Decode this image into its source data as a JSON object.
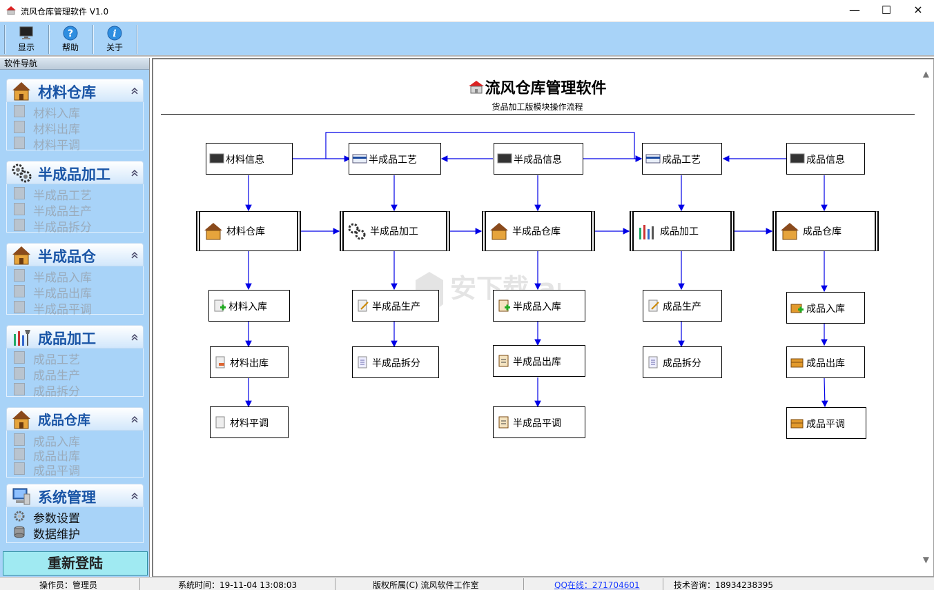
{
  "window": {
    "title": "流风仓库管理软件 V1.0",
    "min_glyph": "—",
    "max_glyph": "☐",
    "close_glyph": "✕"
  },
  "toolbar": {
    "buttons": [
      {
        "label": "显示",
        "icon": "monitor-icon"
      },
      {
        "label": "帮助",
        "icon": "help-icon"
      },
      {
        "label": "关于",
        "icon": "info-icon"
      }
    ]
  },
  "sidebar": {
    "title": "软件导航",
    "groups": [
      {
        "title": "材料仓库",
        "icon": "warehouse-house-icon",
        "items": [
          "材料入库",
          "材料出库",
          "材料平调"
        ],
        "active": false
      },
      {
        "title": "半成品加工",
        "icon": "gears-icon",
        "items": [
          "半成品工艺",
          "半成品生产",
          "半成品拆分"
        ],
        "active": false
      },
      {
        "title": "半成品仓",
        "icon": "warehouse-house-icon",
        "items": [
          "半成品入库",
          "半成品出库",
          "半成品平调"
        ],
        "active": false
      },
      {
        "title": "成品加工",
        "icon": "tools-icon",
        "items": [
          "成品工艺",
          "成品生产",
          "成品拆分"
        ],
        "active": false
      },
      {
        "title": "成品仓库",
        "icon": "warehouse-house-icon",
        "items": [
          "成品入库",
          "成品出库",
          "成品平调"
        ],
        "active": false
      },
      {
        "title": "系统管理",
        "icon": "computer-icon",
        "items": [
          "参数设置",
          "数据维护"
        ],
        "active": true
      }
    ],
    "relogin": "重新登陆"
  },
  "main": {
    "title": "流风仓库管理软件",
    "subtitle": "货品加工版模块操作流程",
    "flow": {
      "material_info": "材料信息",
      "semi_process": "半成品工艺",
      "semi_info": "半成品信息",
      "product_process": "成品工艺",
      "product_info": "成品信息",
      "material_wh": "材料仓库",
      "semi_machining": "半成品加工",
      "semi_wh": "半成品仓库",
      "product_machining": "成品加工",
      "product_wh": "成品仓库",
      "material_in": "材料入库",
      "semi_produce": "半成品生产",
      "semi_in": "半成品入库",
      "product_produce": "成品生产",
      "product_in": "成品入库",
      "material_out": "材料出库",
      "semi_split": "半成品拆分",
      "semi_out": "半成品出库",
      "product_split": "成品拆分",
      "product_out": "成品出库",
      "material_transfer": "材料平调",
      "semi_transfer": "半成品平调",
      "product_transfer": "成品平调"
    },
    "watermark": "安下载 anxz.com"
  },
  "status": {
    "operator": "操作员：管理员",
    "time": "系统时间：19-11-04 13:08:03",
    "copyright": "版权所属(C) 流风软件工作室",
    "qq": "QQ在线：271704601",
    "support": "技术咨询：18934238395"
  }
}
